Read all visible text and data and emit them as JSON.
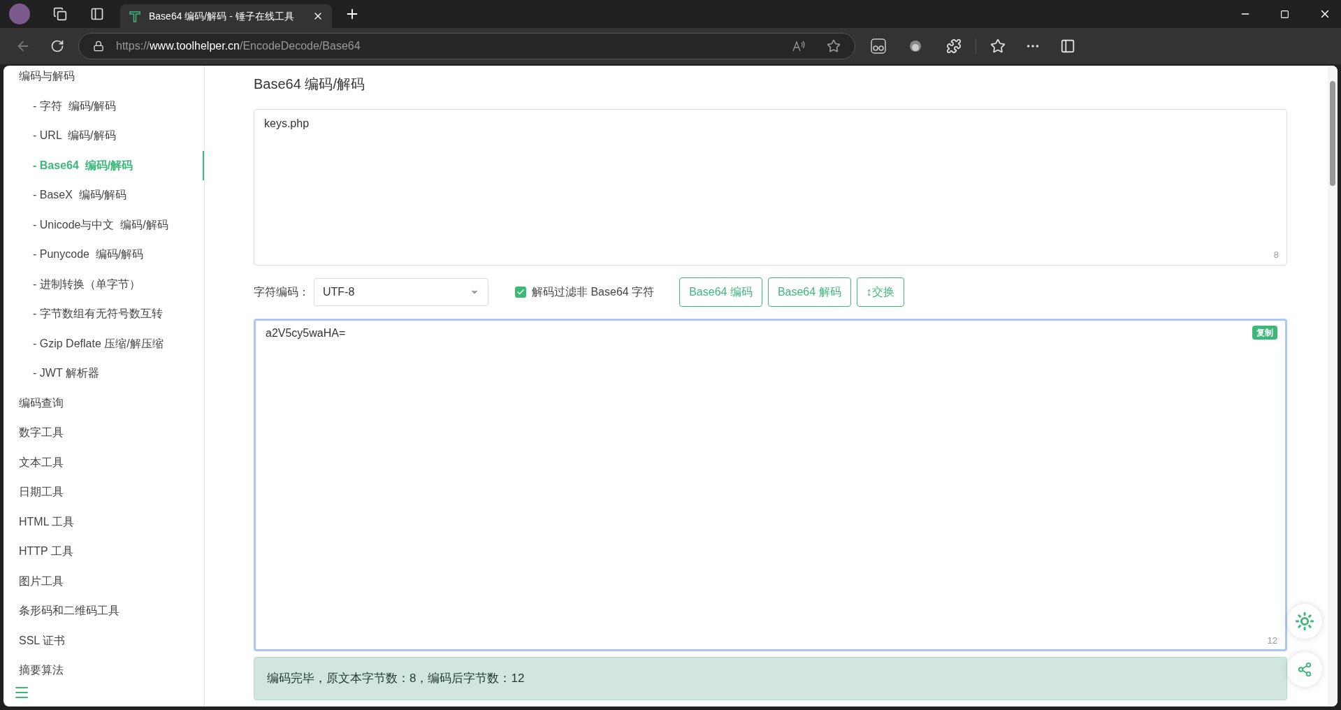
{
  "browser": {
    "tab": {
      "title": "Base64 编码/解码 - 锤子在线工具",
      "selected": true
    },
    "address": {
      "scheme": "https://",
      "host": "www.toolhelper.cn",
      "path": "/EncodeDecode/Base64"
    }
  },
  "sidebar": {
    "items": [
      {
        "label": "编码与解码",
        "selected": false,
        "children": [
          {
            "label": "- 字符  编码/解码",
            "selected": false
          },
          {
            "label": "- URL  编码/解码",
            "selected": false
          },
          {
            "label": "- Base64  编码/解码",
            "selected": true
          },
          {
            "label": "- BaseX  编码/解码",
            "selected": false
          },
          {
            "label": "- Unicode与中文  编码/解码",
            "selected": false
          },
          {
            "label": "- Punycode  编码/解码",
            "selected": false
          },
          {
            "label": "- 进制转换（单字节）",
            "selected": false
          },
          {
            "label": "- 字节数组有无符号数互转",
            "selected": false
          },
          {
            "label": "- Gzip Deflate 压缩/解压缩",
            "selected": false
          },
          {
            "label": "- JWT 解析器",
            "selected": false
          }
        ]
      },
      {
        "label": "编码查询",
        "selected": false
      },
      {
        "label": "数字工具",
        "selected": false
      },
      {
        "label": "文本工具",
        "selected": false
      },
      {
        "label": "日期工具",
        "selected": false
      },
      {
        "label": "HTML 工具",
        "selected": false
      },
      {
        "label": "HTTP 工具",
        "selected": false
      },
      {
        "label": "图片工具",
        "selected": false
      },
      {
        "label": "条形码和二维码工具",
        "selected": false
      },
      {
        "label": "SSL 证书",
        "selected": false
      },
      {
        "label": "摘要算法",
        "selected": false
      }
    ]
  },
  "page": {
    "title": "Base64 编码/解码",
    "input": {
      "value": "keys.php",
      "count": "8"
    },
    "charset": {
      "label": "字符编码：",
      "value": "UTF-8"
    },
    "filter": {
      "label": "解码过滤非 Base64 字符",
      "checked": true
    },
    "buttons": [
      "Base64 编码",
      "Base64 解码",
      "↕交换"
    ],
    "output": {
      "value": "a2V5cy5waHA=",
      "count": "12",
      "copy": "复制",
      "focused": true
    },
    "status": "编码完毕，原文本字节数：8，编码后字节数：12"
  }
}
